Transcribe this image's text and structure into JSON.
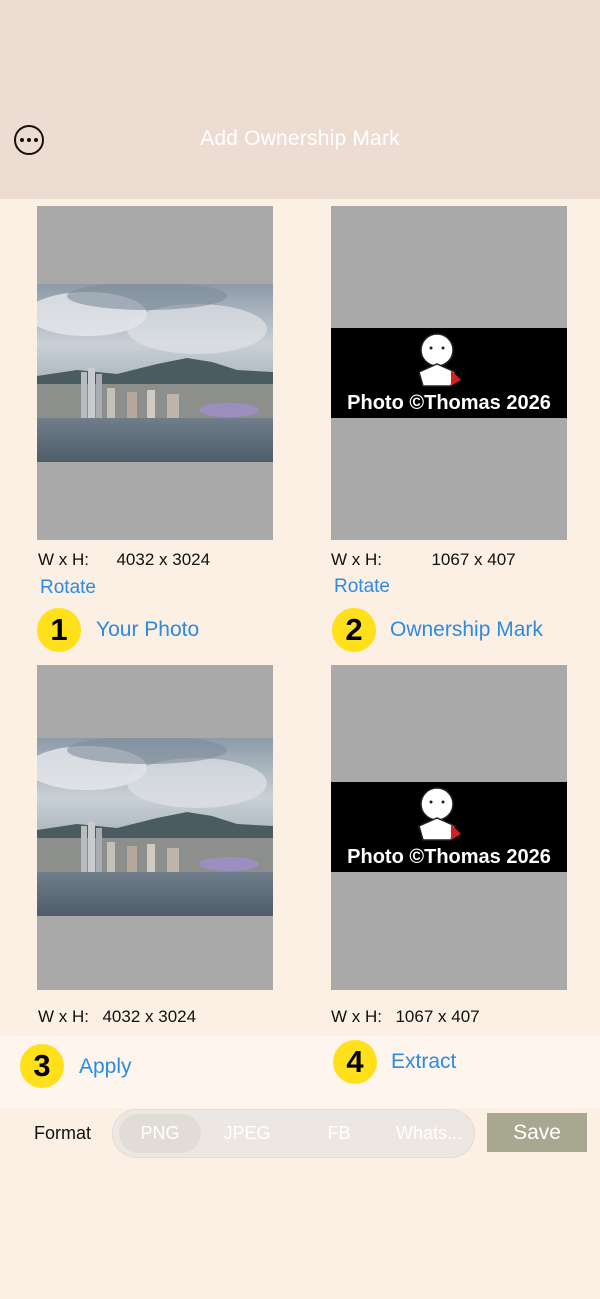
{
  "header": {
    "title": "Add Ownership Mark",
    "menu_icon": "ellipsis-circle-icon"
  },
  "your_photo": {
    "dimensions_label": "W x H:",
    "dimensions_value": "4032 x 3024",
    "rotate_label": "Rotate",
    "step_number": "1",
    "step_label": "Your Photo"
  },
  "ownership_mark": {
    "dimensions_label": "W x H:",
    "dimensions_value": "1067 x 407",
    "rotate_label": "Rotate",
    "step_number": "2",
    "step_label": "Ownership Mark",
    "mark_text": "Photo ©Thomas 2026"
  },
  "result_photo": {
    "dimensions_label": "W x H:",
    "dimensions_value": "4032 x 3024",
    "step_number": "3",
    "step_label": "Apply"
  },
  "extracted_mark": {
    "dimensions_label": "W x H:",
    "dimensions_value": "1067 x 407",
    "step_number": "4",
    "step_label": "Extract",
    "mark_text": "Photo ©Thomas 2026"
  },
  "export": {
    "format_label": "Format",
    "options": [
      "PNG",
      "JPEG",
      "FB",
      "Whats..."
    ],
    "selected": "PNG",
    "save_label": "Save"
  },
  "colors": {
    "link": "#2d8be0",
    "badge": "#ffe01b",
    "header_bg": "#ecdcd1",
    "page_bg": "#fcefe4",
    "save_bg": "#a7a88f"
  }
}
